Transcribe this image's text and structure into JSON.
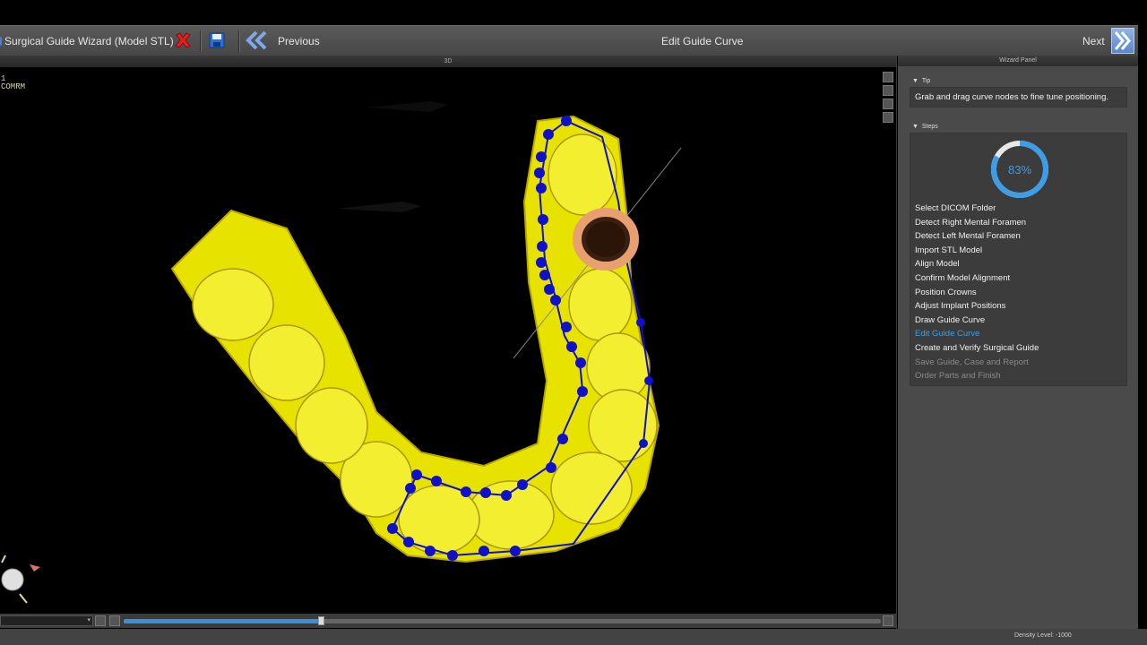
{
  "toolbar": {
    "title": "Surgical Guide Wizard (Model STL)",
    "close_icon": "red-x-icon",
    "save_icon": "floppy-disk-icon",
    "previous_label": "Previous",
    "step_title": "Edit Guide Curve",
    "next_label": "Next"
  },
  "viewport": {
    "title": "3D",
    "overlay_line1": "1",
    "overlay_line2": "COMRM",
    "model_color": "#e8e200",
    "curve_color": "#1010c8",
    "sleeve_color": "#e8a070"
  },
  "bottom": {
    "slider_fraction": 0.26
  },
  "panel": {
    "title": "Wizard Panel",
    "tip_header": "Tip",
    "tip_text": "Grab and drag curve nodes to fine tune positioning.",
    "steps_header": "Steps",
    "progress_label": "83%",
    "progress_value": 0.83,
    "accent_color": "#3a9ee8",
    "steps": [
      {
        "label": "Select DICOM Folder",
        "state": "done"
      },
      {
        "label": "Detect Right Mental Foramen",
        "state": "done"
      },
      {
        "label": "Detect Left Mental Foramen",
        "state": "done"
      },
      {
        "label": "Import STL Model",
        "state": "done"
      },
      {
        "label": "Align Model",
        "state": "done"
      },
      {
        "label": "Confirm Model Alignment",
        "state": "done"
      },
      {
        "label": "Position Crowns",
        "state": "done"
      },
      {
        "label": "Adjust Implant Positions",
        "state": "done"
      },
      {
        "label": "Draw Guide Curve",
        "state": "done"
      },
      {
        "label": "Edit Guide Curve",
        "state": "active"
      },
      {
        "label": "Create and Verify Surgical Guide",
        "state": "done"
      },
      {
        "label": "Save Guide, Case and Report",
        "state": "disabled"
      },
      {
        "label": "Order Parts and Finish",
        "state": "disabled"
      }
    ]
  },
  "status": {
    "density": "Density Level: -1000"
  }
}
